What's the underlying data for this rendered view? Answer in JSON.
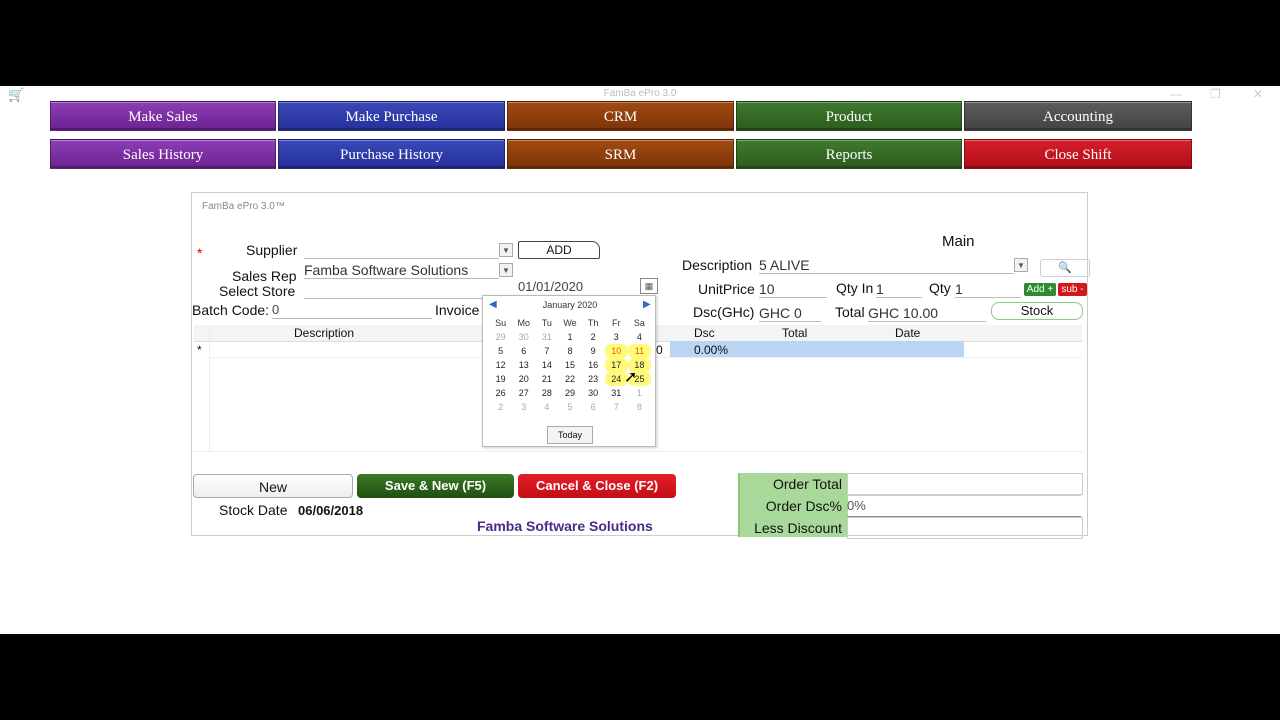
{
  "window": {
    "title": "FamBa ePro 3.0",
    "min": "—",
    "max": "❐",
    "close": "✕"
  },
  "nav": {
    "row1": [
      "Make Sales",
      "Make Purchase",
      "CRM",
      "Product",
      "Accounting"
    ],
    "row2": [
      "Sales History",
      "Purchase History",
      "SRM",
      "Reports",
      "Close Shift"
    ]
  },
  "panel": {
    "title": "FamBa ePro 3.0™",
    "required_mark": "*",
    "supplier_label": "Supplier",
    "supplier_value": "",
    "add_button": "ADD",
    "sales_rep_label": "Sales Rep",
    "sales_rep_value": "Famba Software Solutions",
    "select_store_label": "Select Store",
    "select_store_value": "",
    "date_value": "01/01/2020",
    "batch_code_label": "Batch Code:",
    "batch_code_value": "0",
    "invoice_label": "Invoice",
    "main_label": "Main",
    "description_label": "Description",
    "description_value": "5 ALIVE",
    "unit_price_label": "UnitPrice",
    "unit_price_value": "10",
    "qty_in_label": "Qty In",
    "qty_in_value": "1",
    "qty_label": "Qty",
    "qty_value": "1",
    "add_plus": "Add +",
    "sub_minus": "sub -",
    "dsc_label": "Dsc(GHc)",
    "dsc_value": "GHC 0",
    "total_label": "Total",
    "total_value": "GHC 10.00",
    "stock_button": "Stock",
    "grid_headers": {
      "description": "Description",
      "dsc": "Dsc",
      "total": "Total",
      "date": "Date"
    },
    "row_marker": "*",
    "row_zero": "0",
    "row_dsc": "0.00%",
    "new_button": "New",
    "save_button": "Save & New (F5)",
    "cancel_button": "Cancel & Close (F2)",
    "stock_date_label": "Stock Date",
    "stock_date_value": "06/06/2018",
    "company": "Famba Software Solutions",
    "order_total_label": "Order Total",
    "order_total_value": "",
    "order_dsc_label": "Order Dsc%",
    "order_dsc_value": "0%",
    "less_discount_label": "Less Discount",
    "less_discount_value": ""
  },
  "calendar": {
    "month": "January 2020",
    "prev": "◀",
    "next": "▶",
    "weekdays": [
      "Su",
      "Mo",
      "Tu",
      "We",
      "Th",
      "Fr",
      "Sa"
    ],
    "weeks": [
      [
        "29",
        "30",
        "31",
        "1",
        "2",
        "3",
        "4"
      ],
      [
        "5",
        "6",
        "7",
        "8",
        "9",
        "10",
        "11"
      ],
      [
        "12",
        "13",
        "14",
        "15",
        "16",
        "17",
        "18"
      ],
      [
        "19",
        "20",
        "21",
        "22",
        "23",
        "24",
        "25"
      ],
      [
        "26",
        "27",
        "28",
        "29",
        "30",
        "31",
        "1"
      ],
      [
        "2",
        "3",
        "4",
        "5",
        "6",
        "7",
        "8"
      ]
    ],
    "today_button": "Today",
    "highlight_color": "#fffa7a"
  },
  "colors": {
    "purple": "#7a2da3",
    "blue": "#2f3aa8",
    "brown": "#8f3e0c",
    "green": "#366b26",
    "gray": "#505050",
    "red": "#c4141f"
  }
}
